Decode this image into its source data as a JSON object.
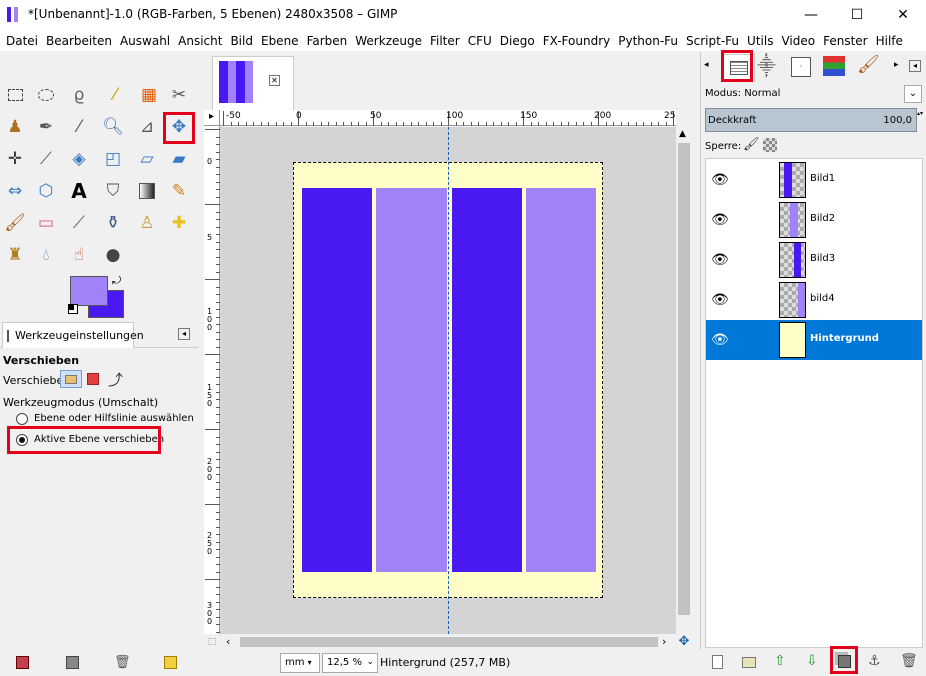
{
  "window": {
    "title": "*[Unbenannt]-1.0 (RGB-Farben, 5 Ebenen) 2480x3508 – GIMP",
    "controls": [
      "—",
      "☐",
      "✕"
    ]
  },
  "menu": [
    "Datei",
    "Bearbeiten",
    "Auswahl",
    "Ansicht",
    "Bild",
    "Ebene",
    "Farben",
    "Werkzeuge",
    "Filter",
    "CFU",
    "Diego",
    "FX-Foundry",
    "Python-Fu",
    "Script-Fu",
    "Utils",
    "Video",
    "Fenster",
    "Hilfe"
  ],
  "colors": {
    "foreground": "#a182f8",
    "background": "#4a18f0",
    "stripe_dark": "#4a18f0",
    "stripe_light": "#a182f8",
    "canvas_bg": "#fffdc8",
    "highlight": "#e2001a",
    "selection": "#0078d7"
  },
  "tool_options": {
    "tab_label": "Werkzeugeinstellungen",
    "tool_name": "Verschieben",
    "move_label": "Verschieben:",
    "mode_label": "Werkzeugmodus (Umschalt)",
    "option1": "Ebene oder Hilfslinie auswählen",
    "option2": "Aktive Ebene verschieben"
  },
  "ruler": {
    "top_labels": [
      "-50",
      "0",
      "50",
      "100",
      "150",
      "200",
      "25"
    ],
    "left_labels": [
      "0",
      "5",
      "1 0 0",
      "1 5 0",
      "2 0 0",
      "2 5 0",
      "3 0 0",
      "3"
    ]
  },
  "status": {
    "unit": "mm",
    "zoom": "12,5 %",
    "info": "Hintergrund (257,7 MB)"
  },
  "layers_panel": {
    "mode_label": "Modus: Normal",
    "opacity_label": "Deckkraft",
    "opacity_value": "100,0",
    "lock_label": "Sperre:",
    "layers": [
      {
        "name": "Bild1"
      },
      {
        "name": "Bild2"
      },
      {
        "name": "Bild3"
      },
      {
        "name": "bild4"
      },
      {
        "name": "Hintergrund"
      }
    ]
  }
}
